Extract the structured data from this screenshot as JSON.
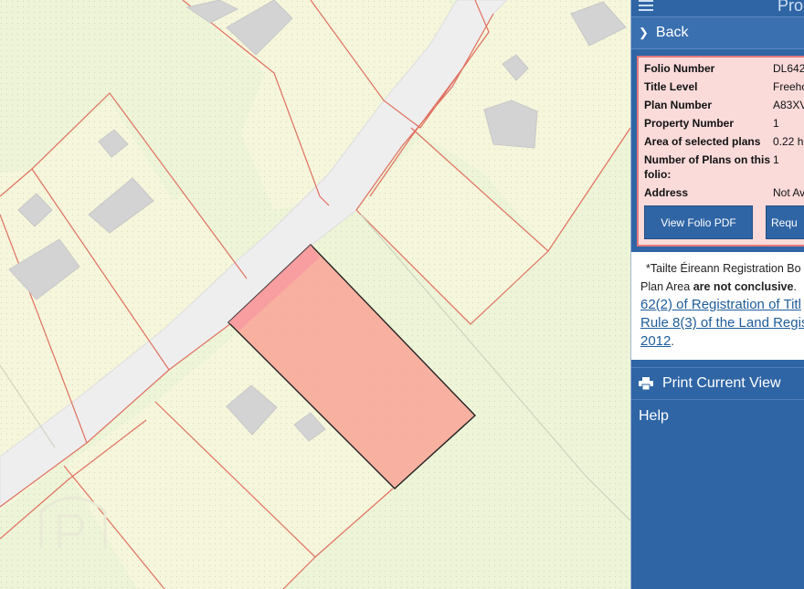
{
  "panel": {
    "title_fragment": "Pro",
    "back_label": "Back",
    "info": {
      "rows": [
        {
          "label": "Folio Number",
          "value": "DL642"
        },
        {
          "label": "Title Level",
          "value": "Freeho"
        },
        {
          "label": "Plan Number",
          "value": "A83XV"
        },
        {
          "label": "Property Number",
          "value": "1"
        },
        {
          "label": "Area of selected plans",
          "value": "0.22 h"
        },
        {
          "label": "Number of Plans on this folio:",
          "value": "1"
        },
        {
          "label": "Address",
          "value": "Not Av"
        }
      ],
      "view_pdf_label": "View Folio PDF",
      "request_label": "Requ"
    },
    "disclaimer": {
      "line1": "*Tailte Éireann Registration Bo",
      "line2_prefix": "Plan Area ",
      "line2_bold": "are not conclusive",
      "line2_suffix": ".",
      "link1": "62(2) of Registration of Titl",
      "link2": "Rule 8(3) of the Land Regis",
      "link3": "2012",
      "link3_suffix": "."
    },
    "print_label": "Print Current View",
    "help_label": "Help"
  },
  "map": {
    "selected_fill": "#f8a99a",
    "boundary_color": "#e07060",
    "building_color": "#d3d3d3"
  }
}
